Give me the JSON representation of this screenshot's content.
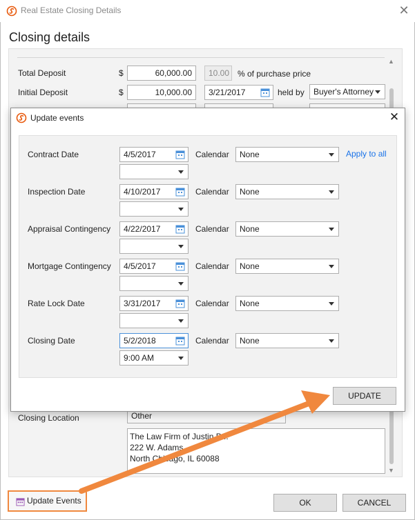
{
  "window": {
    "title": "Real Estate Closing Details"
  },
  "heading": "Closing details",
  "deposit": {
    "total_label": "Total Deposit",
    "currency": "$",
    "total_value": "60,000.00",
    "percent_value": "10.00",
    "percent_label": "% of purchase price",
    "initial_label": "Initial Deposit",
    "initial_value": "10,000.00",
    "initial_date": "3/21/2017",
    "held_by_label": "held by",
    "held_by_value": "Buyer's Attorney"
  },
  "closing_location": {
    "label": "Closing Location",
    "type_value": "Other",
    "address_lines": [
      "The Law Firm of Justin B...",
      "222 W. Adams",
      "North Chicago, IL 60088"
    ]
  },
  "dialog": {
    "title": "Update events",
    "calendar_label": "Calendar",
    "apply_all": "Apply to all",
    "update_button": "UPDATE",
    "events": [
      {
        "name": "Contract Date",
        "date": "4/5/2017",
        "time": "",
        "calendar": "None"
      },
      {
        "name": "Inspection Date",
        "date": "4/10/2017",
        "time": "",
        "calendar": "None"
      },
      {
        "name": "Appraisal Contingency",
        "date": "4/22/2017",
        "time": "",
        "calendar": "None"
      },
      {
        "name": "Mortgage Contingency",
        "date": "4/5/2017",
        "time": "",
        "calendar": "None"
      },
      {
        "name": "Rate Lock Date",
        "date": "3/31/2017",
        "time": "",
        "calendar": "None"
      },
      {
        "name": "Closing Date",
        "date": "5/2/2018",
        "time": "9:00 AM",
        "calendar": "None"
      }
    ]
  },
  "footer": {
    "update_events": "Update Events",
    "ok": "OK",
    "cancel": "CANCEL"
  },
  "colors": {
    "accent_orange": "#f0883e",
    "link_blue": "#1a73e8",
    "logo_orange": "#e8590c"
  }
}
